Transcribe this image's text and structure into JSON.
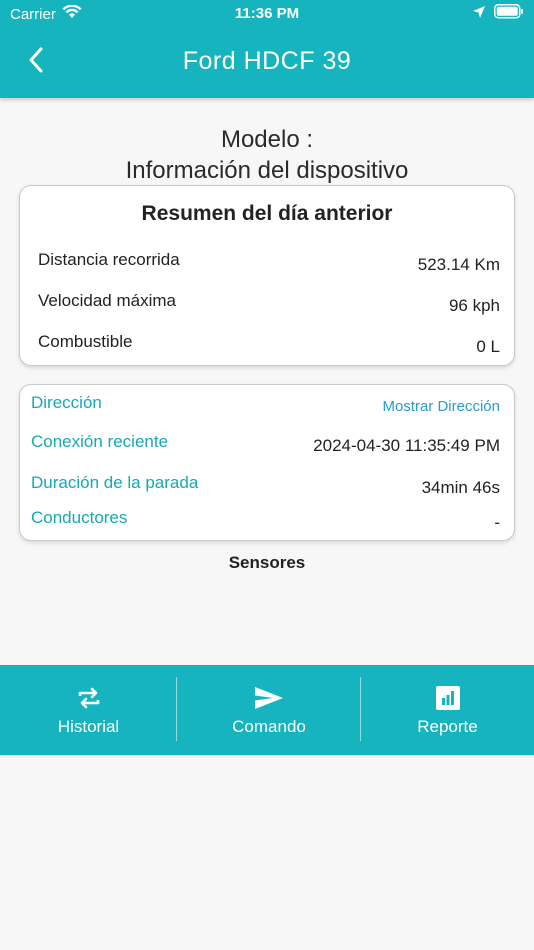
{
  "status_bar": {
    "carrier": "Carrier",
    "time": "11:36 PM"
  },
  "nav": {
    "title": "Ford HDCF 39",
    "back_icon": "chevron-left-icon"
  },
  "model": {
    "line1": "Modelo :",
    "line2": "Información del dispositivo"
  },
  "summary": {
    "title": "Resumen del día anterior",
    "rows": [
      {
        "label": "Distancia recorrida",
        "value": "523.14 Km"
      },
      {
        "label": "Velocidad máxima",
        "value": "96 kph"
      },
      {
        "label": "Combustible",
        "value": "0 L"
      }
    ]
  },
  "info": {
    "rows": [
      {
        "label": "Dirección",
        "value": "Mostrar Dirección"
      },
      {
        "label": "Conexión reciente",
        "value": "2024-04-30 11:35:49 PM"
      },
      {
        "label": "Duración de la parada",
        "value": "34min 46s"
      },
      {
        "label": "Conductores",
        "value": "-"
      }
    ]
  },
  "sensors": {
    "title": "Sensores"
  },
  "tabs": [
    {
      "label": "Historial",
      "icon": "repeat-icon"
    },
    {
      "label": "Comando",
      "icon": "send-icon"
    },
    {
      "label": "Reporte",
      "icon": "bar-chart-icon"
    }
  ],
  "colors": {
    "primary": "#16b4be",
    "info_label": "#16a9b4",
    "link": "#2a9bd0"
  }
}
